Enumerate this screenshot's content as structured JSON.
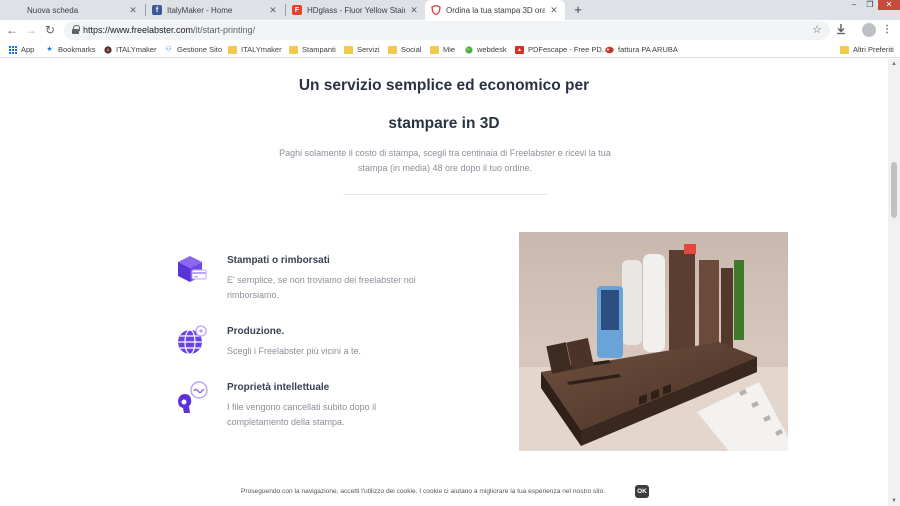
{
  "colors": {
    "accent_purple": "#6a42e8",
    "heading": "#2a3344",
    "muted_text": "#8a8f99",
    "tab_strip": "#dee1e6"
  },
  "browser": {
    "tabs": [
      {
        "title": "Nuova scheda",
        "icon": "blank-page-icon",
        "active": false
      },
      {
        "title": "ItalyMaker - Home",
        "icon": "facebook-icon",
        "active": false
      },
      {
        "title": "HDglass - Fluor Yellow Stained [PE...",
        "icon": "hdglass-icon",
        "active": false
      },
      {
        "title": "Ordina la tua stampa 3D ora",
        "icon": "freelabster-shield-icon",
        "active": true
      }
    ],
    "url_host": "https://www.freelabster.com",
    "url_path": "/it/start-printing/",
    "bookmarks": [
      {
        "label": "App",
        "icon": "apps-grid-icon"
      },
      {
        "label": "Bookmarks",
        "icon": "star-icon"
      },
      {
        "label": "ITALYmaker",
        "icon": "italymaker-icon"
      },
      {
        "label": "Gestione Sito",
        "icon": "people-icon"
      },
      {
        "label": "ITALYmaker",
        "icon": "folder-icon"
      },
      {
        "label": "Stampanti",
        "icon": "folder-icon"
      },
      {
        "label": "Servizi",
        "icon": "folder-icon"
      },
      {
        "label": "Social",
        "icon": "folder-icon"
      },
      {
        "label": "Mie",
        "icon": "folder-icon"
      },
      {
        "label": "webdesk",
        "icon": "globe-icon"
      },
      {
        "label": "PDFescape - Free PD...",
        "icon": "pdf-icon"
      },
      {
        "label": "fattura PA ARUBA",
        "icon": "aruba-icon"
      },
      {
        "label": "Altri Preferiti",
        "icon": "folder-icon"
      }
    ]
  },
  "hero": {
    "title_line1": "Un servizio semplice ed economico per",
    "title_line2": "stampare in 3D",
    "subtitle": "Paghi solamente il costo di stampa, scegli tra centinaia di Freelabster e ricevi la tua stampa (in media) 48 ore dopo il tuo ordine."
  },
  "features": [
    {
      "title": "Stampati o rimborsati",
      "desc": "E' semplice, se non troviamo dei freelabster noi rimborsiamo.",
      "icon": "refund-box-icon"
    },
    {
      "title": "Produzione.",
      "desc": "Scegli i Freelabster più vicini a te.",
      "icon": "globe-network-icon"
    },
    {
      "title": "Proprietà intellettuale",
      "desc": "I file vengono cancellati subito dopo il completamento della stampa.",
      "icon": "thinking-head-icon"
    }
  ],
  "cookie": {
    "text": "Proseguendo con la navigazione, accetti l'utilizzo dei cookie. I cookie ci aiutano a migliorare la tua esperienza nel nostro sito.",
    "ok_label": "OK"
  }
}
